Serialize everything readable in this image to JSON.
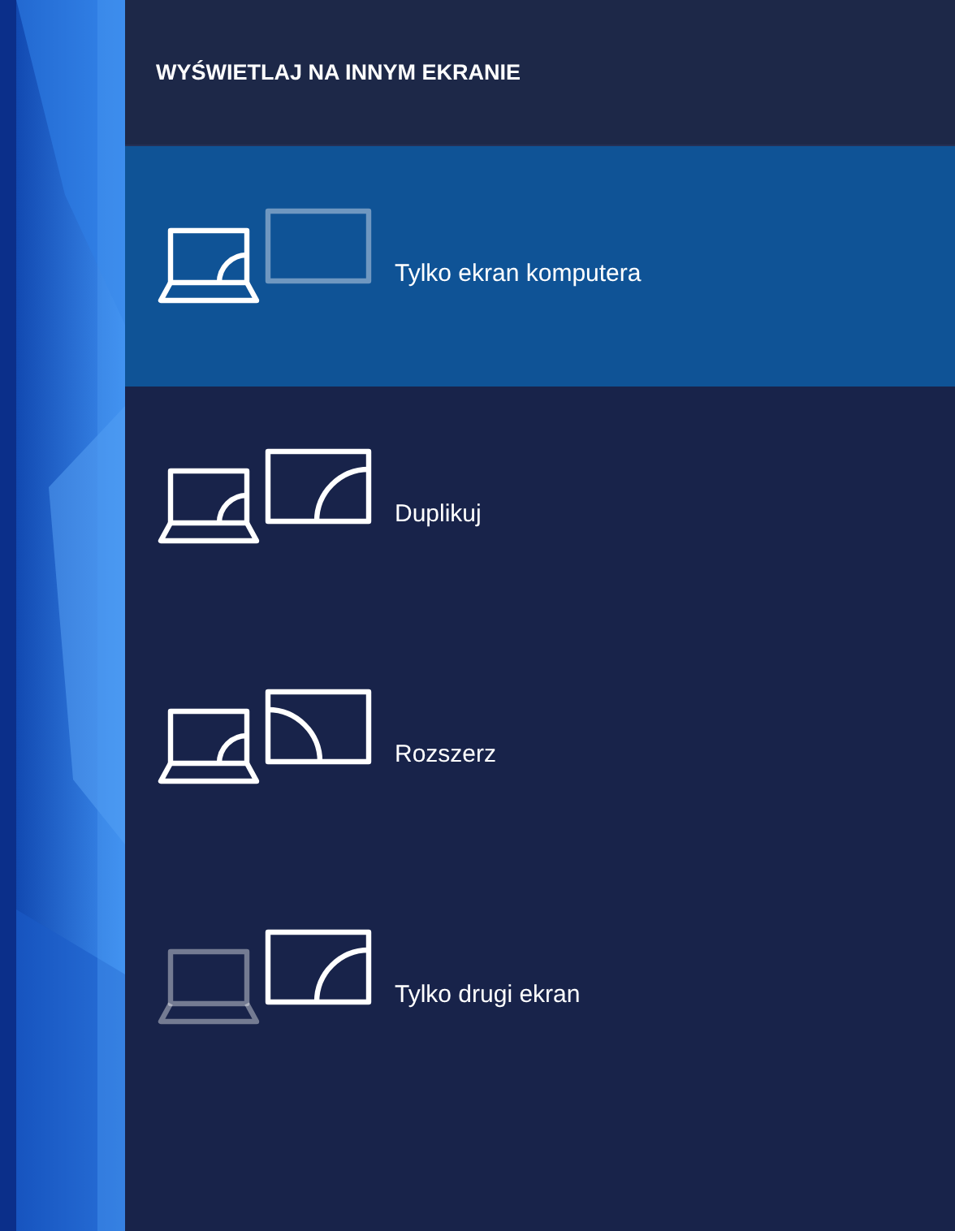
{
  "header": {
    "title": "WYŚWIETLAJ NA INNYM EKRANIE"
  },
  "options": [
    {
      "label": "Tylko ekran komputera",
      "kind": "pc-only",
      "selected": true
    },
    {
      "label": "Duplikuj",
      "kind": "duplicate",
      "selected": false
    },
    {
      "label": "Rozszerz",
      "kind": "extend",
      "selected": false
    },
    {
      "label": "Tylko drugi ekran",
      "kind": "second-only",
      "selected": false
    }
  ]
}
